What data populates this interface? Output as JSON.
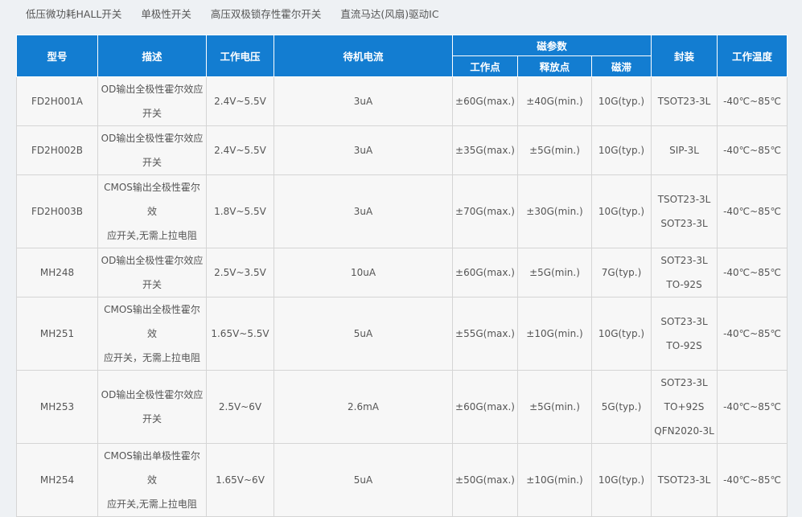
{
  "tabs": [
    "低压微功耗HALL开关",
    "单极性开关",
    "高压双极锁存性霍尔开关",
    "直流马达(风扇)驱动IC"
  ],
  "table": {
    "headers": {
      "model": "型号",
      "description": "描述",
      "voltage": "工作电压",
      "standby_current": "待机电流",
      "magnetic_params": "磁参数",
      "operate_point": "工作点",
      "release_point": "释放点",
      "hysteresis": "磁滞",
      "package": "封装",
      "temperature": "工作温度"
    },
    "rows": [
      {
        "model": "FD2H001A",
        "desc": [
          "OD输出全极性霍尔效应",
          "开关"
        ],
        "voltage": "2.4V~5.5V",
        "current": "3uA",
        "bop": "±60G(max.)",
        "brp": "±40G(min.)",
        "bh": "10G(typ.)",
        "pkg": [
          "TSOT23-3L"
        ],
        "temp": "-40℃~85℃"
      },
      {
        "model": "FD2H002B",
        "desc": [
          "OD输出全极性霍尔效应",
          "开关"
        ],
        "voltage": "2.4V~5.5V",
        "current": "3uA",
        "bop": "±35G(max.)",
        "brp": "±5G(min.)",
        "bh": "10G(typ.)",
        "pkg": [
          "SIP-3L"
        ],
        "temp": "-40℃~85℃"
      },
      {
        "model": "FD2H003B",
        "desc": [
          "CMOS输出全极性霍尔效",
          "应开关,无需上拉电阻"
        ],
        "voltage": "1.8V~5.5V",
        "current": "3uA",
        "bop": "±70G(max.)",
        "brp": "±30G(min.)",
        "bh": "10G(typ.)",
        "pkg": [
          "TSOT23-3L",
          "SOT23-3L"
        ],
        "temp": "-40℃~85℃"
      },
      {
        "model": "MH248",
        "desc": [
          "OD输出全极性霍尔效应",
          "开关"
        ],
        "voltage": "2.5V~3.5V",
        "current": "10uA",
        "bop": "±60G(max.)",
        "brp": "±5G(min.)",
        "bh": "7G(typ.)",
        "pkg": [
          "SOT23-3L",
          "TO-92S"
        ],
        "temp": "-40℃~85℃"
      },
      {
        "model": "MH251",
        "desc": [
          "CMOS输出全极性霍尔效",
          "应开关，无需上拉电阻"
        ],
        "voltage": "1.65V~5.5V",
        "current": "5uA",
        "bop": "±55G(max.)",
        "brp": "±10G(min.)",
        "bh": "10G(typ.)",
        "pkg": [
          "SOT23-3L",
          "TO-92S"
        ],
        "temp": "-40℃~85℃"
      },
      {
        "model": "MH253",
        "desc": [
          "OD输出全极性霍尔效应",
          "开关"
        ],
        "voltage": "2.5V~6V",
        "current": "2.6mA",
        "bop": "±60G(max.)",
        "brp": "±5G(min.)",
        "bh": "5G(typ.)",
        "pkg": [
          "SOT23-3L",
          "TO+92S",
          "QFN2020-3L"
        ],
        "temp": "-40℃~85℃"
      },
      {
        "model": "MH254",
        "desc": [
          "CMOS输出单极性霍尔效",
          "应开关,无需上拉电阻"
        ],
        "voltage": "1.65V~6V",
        "current": "5uA",
        "bop": "±50G(max.)",
        "brp": "±10G(min.)",
        "bh": "10G(typ.)",
        "pkg": [
          "TSOT23-3L"
        ],
        "temp": "-40℃~85℃"
      }
    ]
  }
}
